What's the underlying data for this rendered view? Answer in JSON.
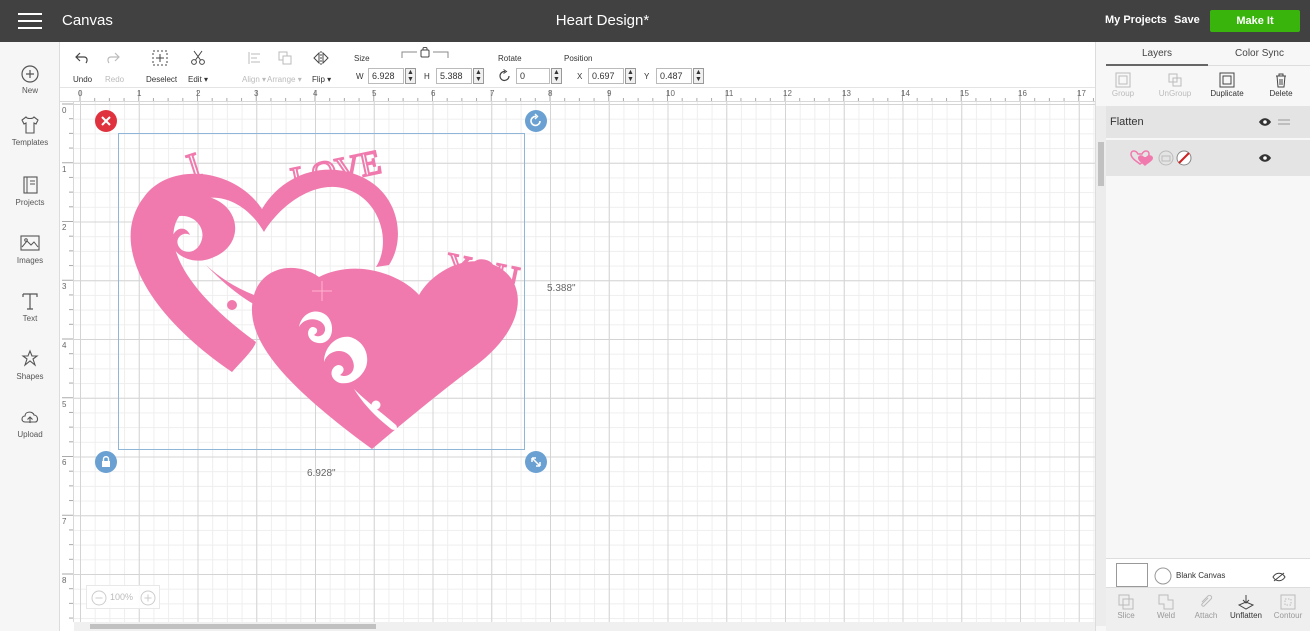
{
  "topbar": {
    "app_name": "Canvas",
    "document_title": "Heart Design*",
    "my_projects": "My Projects",
    "save": "Save",
    "make_it": "Make It",
    "make_it_color": "#38b40c"
  },
  "left_nav": [
    {
      "label": "New",
      "icon": "plus-circle-icon"
    },
    {
      "label": "Templates",
      "icon": "tshirt-icon"
    },
    {
      "label": "Projects",
      "icon": "book-icon"
    },
    {
      "label": "Images",
      "icon": "image-icon"
    },
    {
      "label": "Text",
      "icon": "text-icon"
    },
    {
      "label": "Shapes",
      "icon": "shapes-icon"
    },
    {
      "label": "Upload",
      "icon": "cloud-upload-icon"
    }
  ],
  "toolbar": {
    "undo": "Undo",
    "redo": "Redo",
    "deselect": "Deselect",
    "edit": "Edit",
    "align": "Align",
    "arrange": "Arrange",
    "flip": "Flip",
    "size_label": "Size",
    "w_label": "W",
    "w_value": "6.928",
    "h_label": "H",
    "h_value": "5.388",
    "rotate_label": "Rotate",
    "rotate_value": "0",
    "position_label": "Position",
    "x_label": "X",
    "x_value": "0.697",
    "y_label": "Y",
    "y_value": "0.487"
  },
  "ruler": {
    "top": [
      "0",
      "1",
      "2",
      "3",
      "4",
      "5",
      "6",
      "7",
      "8",
      "9",
      "10",
      "11",
      "12",
      "13",
      "14",
      "15",
      "16",
      "17"
    ],
    "left": [
      "0",
      "1",
      "2",
      "3",
      "4",
      "5",
      "6",
      "7",
      "8"
    ]
  },
  "canvas": {
    "height_label": "5.388\"",
    "width_label": "6.928\"",
    "zoom_level": "100%",
    "design_color": "#f07aad",
    "design_text": {
      "word1": "I",
      "word2": "LOVE",
      "word3": "YOU"
    }
  },
  "right_panel": {
    "tabs": [
      "Layers",
      "Color Sync"
    ],
    "actions": [
      "Group",
      "UnGroup",
      "Duplicate",
      "Delete"
    ],
    "flatten_label": "Flatten",
    "blank_canvas": "Blank Canvas",
    "bottom_actions": [
      "Slice",
      "Weld",
      "Attach",
      "Unflatten",
      "Contour"
    ]
  }
}
